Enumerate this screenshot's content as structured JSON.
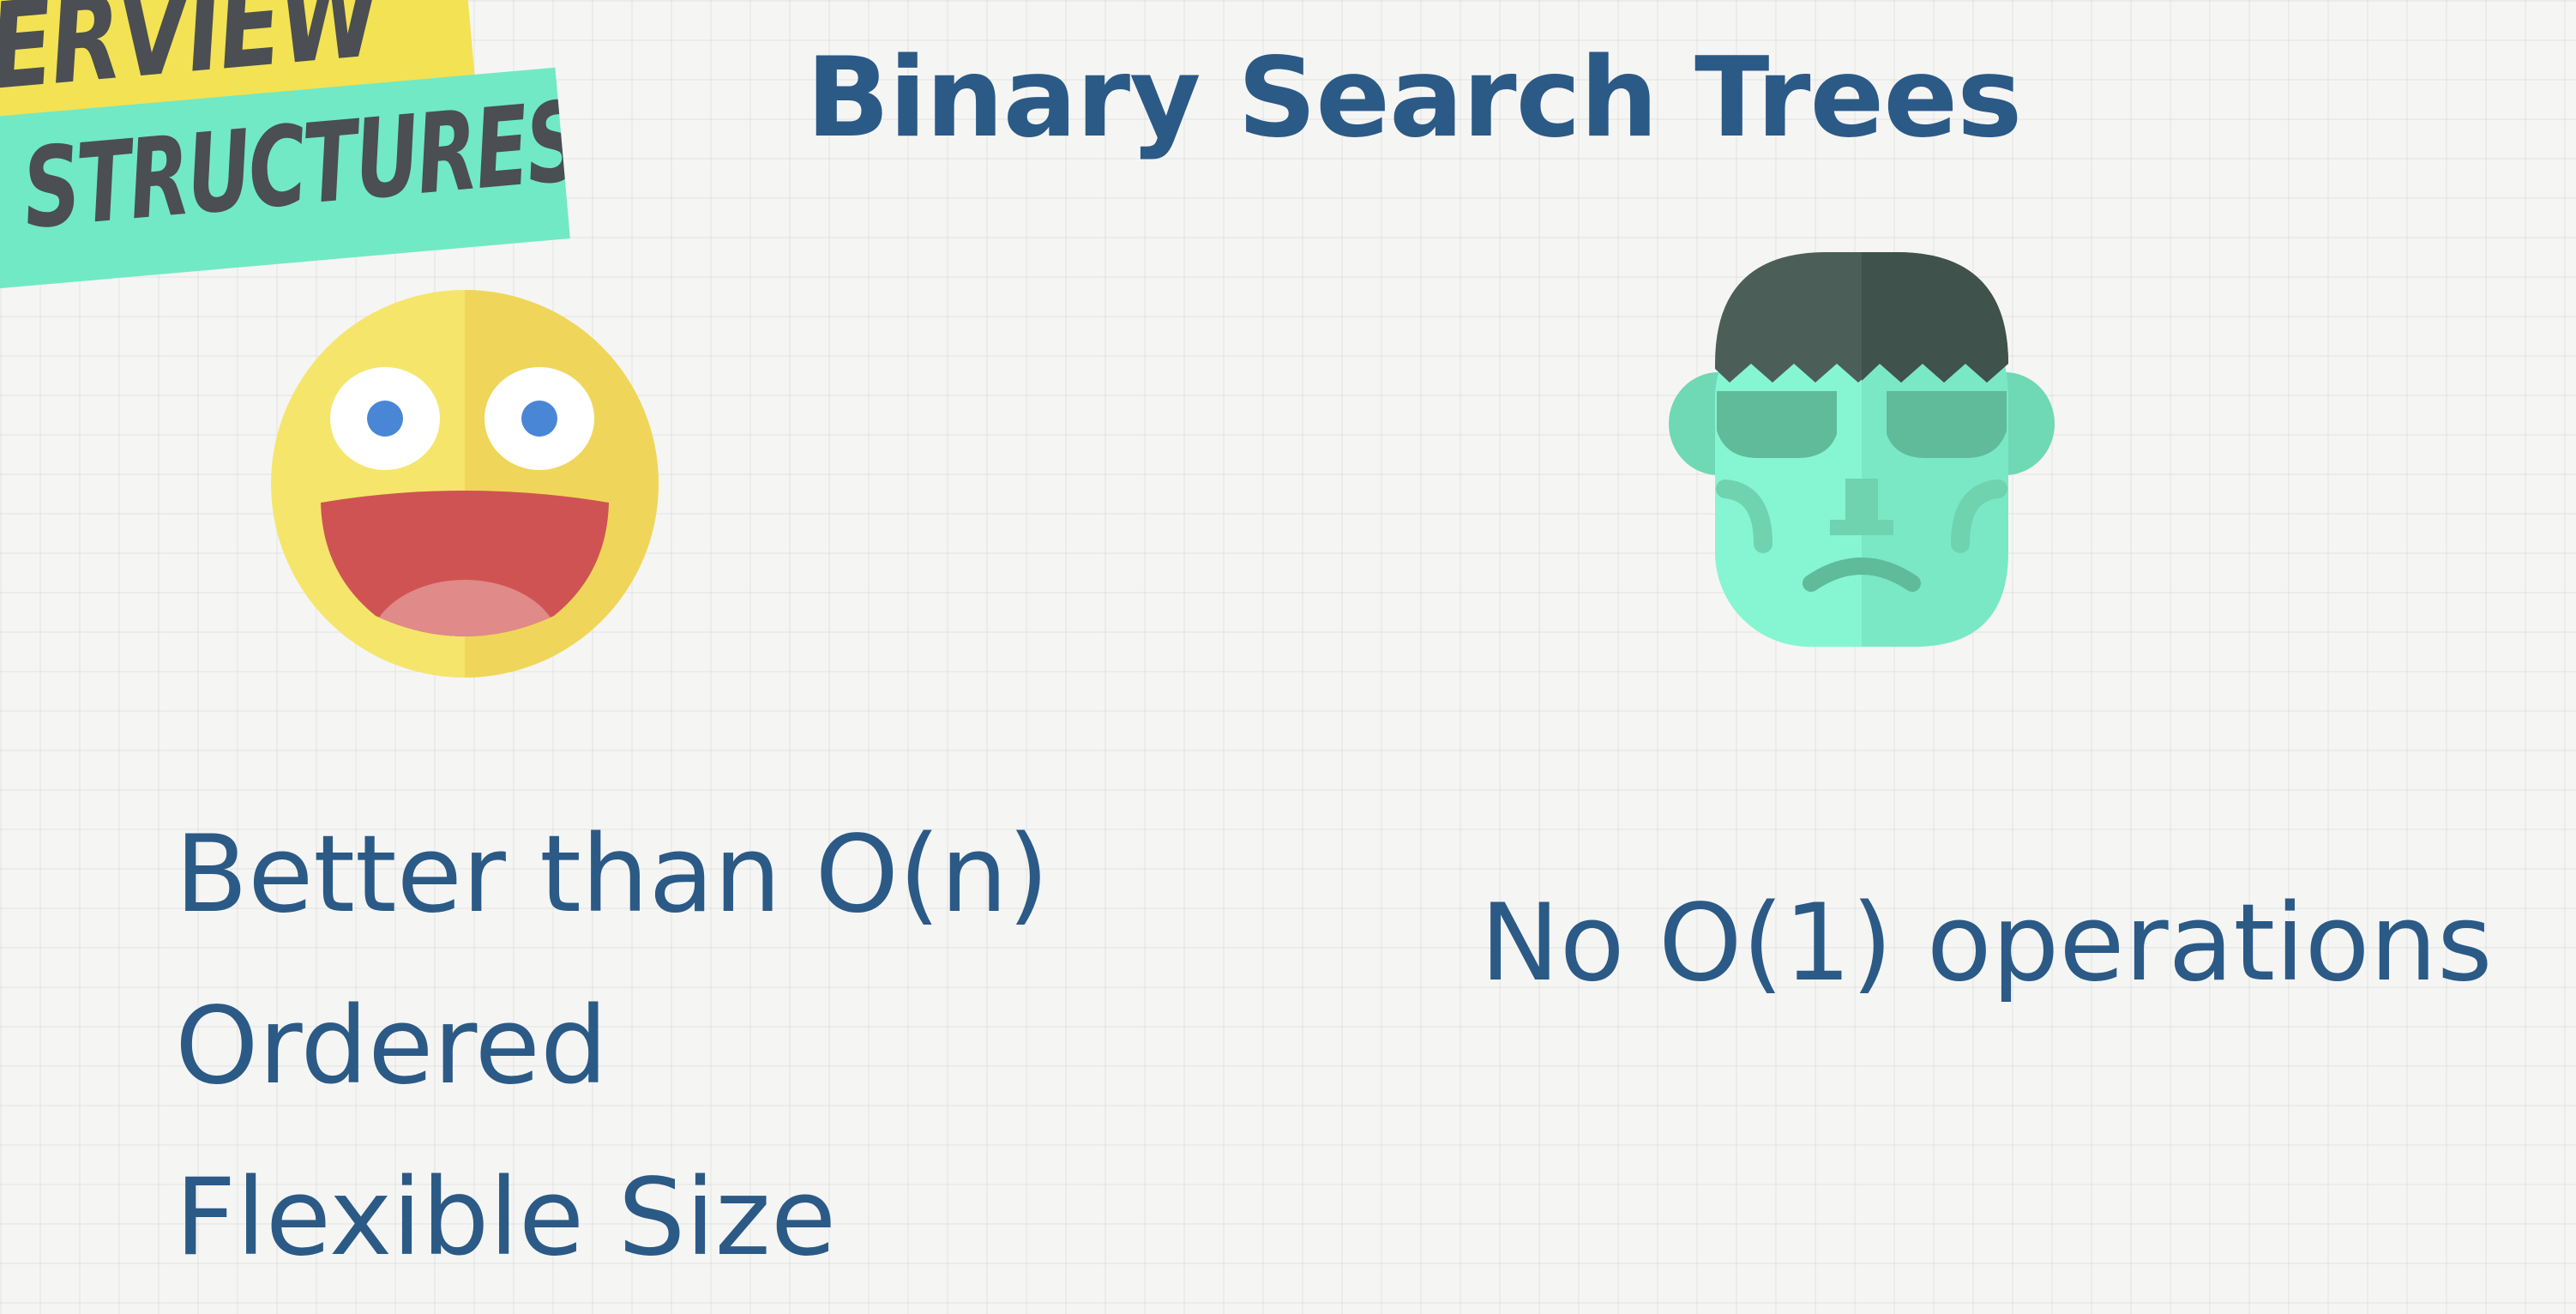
{
  "tags": {
    "top": "ERVIEW",
    "bottom": "STRUCTURES"
  },
  "title": "Binary Search Trees",
  "pros": {
    "icon": "happy-face-icon",
    "items": [
      "Better than O(n)",
      "Ordered",
      "Flexible Size"
    ]
  },
  "cons": {
    "icon": "frankenstein-face-icon",
    "items": [
      "No O(1) operations"
    ]
  },
  "colors": {
    "title_text": "#2b5a86",
    "body_text": "#2b5a86",
    "tag_yellow": "#f3e253",
    "tag_teal": "#71e9c5",
    "tag_text": "#4b4e52",
    "smiley_face": "#f5e56b",
    "smiley_mouth": "#d05353",
    "frank_skin": "#86f5d2",
    "frank_hair": "#425851"
  }
}
